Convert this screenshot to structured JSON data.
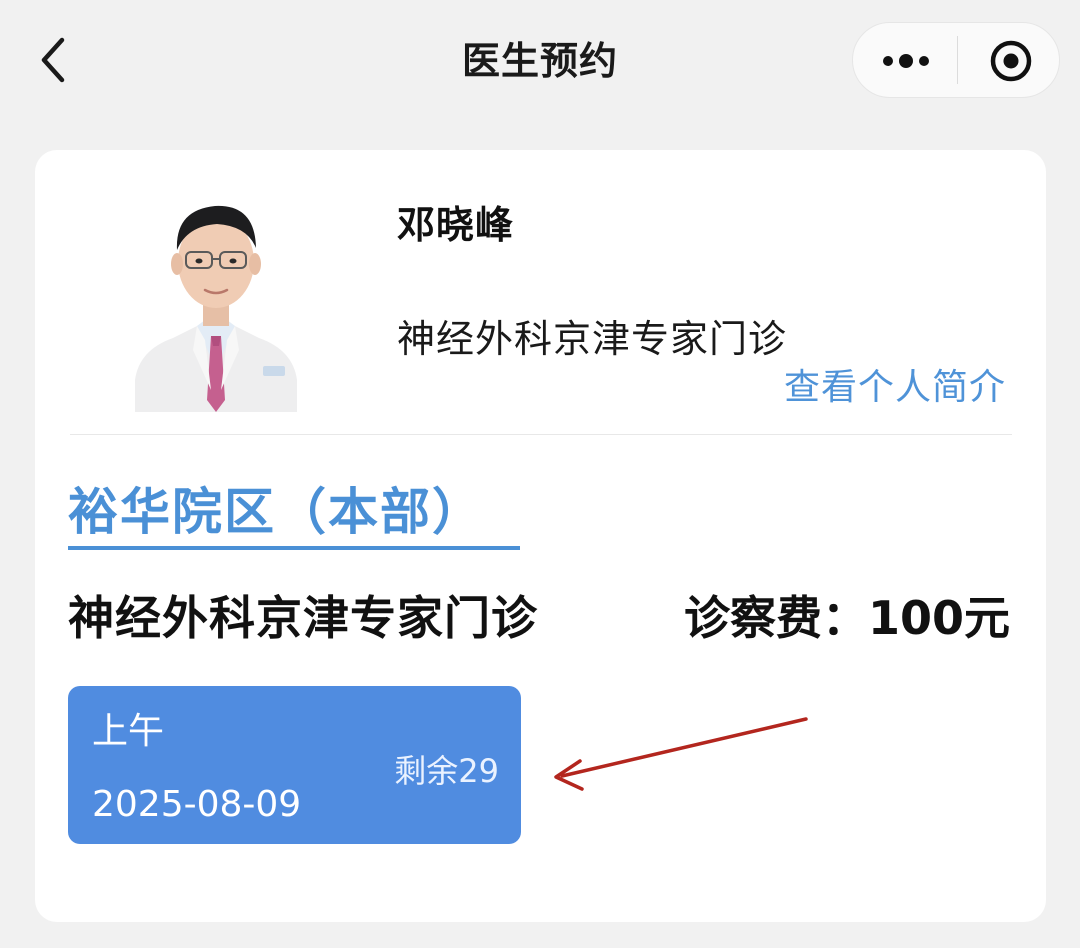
{
  "nav": {
    "title": "医生预约",
    "back_icon": "chevron-left-icon",
    "more_icon": "more-dots-icon",
    "close_icon": "target-close-icon"
  },
  "doctor": {
    "name": "邓晓峰",
    "department": "神经外科京津专家门诊",
    "profile_link": "查看个人简介"
  },
  "campus": {
    "active_tab": "裕华院区（本部）"
  },
  "clinic": {
    "name": "神经外科京津专家门诊",
    "fee_label": "诊察费：100元"
  },
  "slots": [
    {
      "period": "上午",
      "remaining": "剩余29",
      "date": "2025-08-09"
    }
  ],
  "colors": {
    "accent": "#4a90d6",
    "slot_bg": "#508ce0",
    "annotation": "#b3261e"
  }
}
